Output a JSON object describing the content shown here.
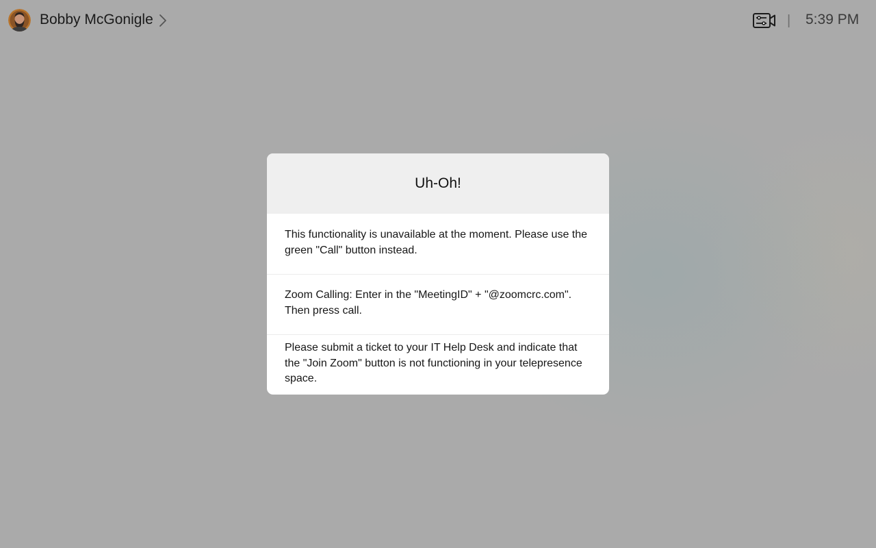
{
  "header": {
    "user_name": "Bobby McGonigle",
    "divider": "|",
    "time": "5:39 PM",
    "icons": {
      "avatar": "user-avatar",
      "chevron": "chevron-right-icon",
      "meeting": "meeting-controls-icon"
    }
  },
  "dialog": {
    "title": "Uh-Oh!",
    "messages": [
      "This functionality is unavailable at the moment. Please use the green \"Call\" button instead.",
      "Zoom Calling: Enter in the \"MeetingID\" + \"@zoomcrc.com\". Then press call.",
      "Please submit a ticket to your IT Help Desk and indicate that the \"Join Zoom\" button is not functioning in your telepresence space."
    ]
  },
  "colors": {
    "backdrop": "#aaaaaa",
    "dialog_header": "#efefef",
    "dialog_body": "#ffffff",
    "text": "#161616"
  }
}
